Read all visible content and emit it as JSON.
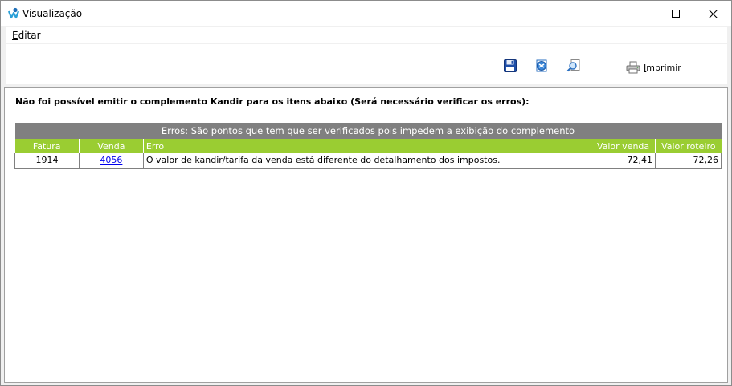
{
  "window": {
    "title": "Visualização"
  },
  "menu": {
    "editar": {
      "mnemonic": "E",
      "rest": "ditar"
    }
  },
  "toolbar": {
    "print_mnemonic": "I",
    "print_rest": "mprimir"
  },
  "content": {
    "message": "Não foi possível emitir o complemento Kandir para os itens abaixo (Será necessário verificar os erros):",
    "table": {
      "caption": "Erros: São pontos que tem que ser verificados pois impedem a exibição do complemento",
      "headers": [
        "Fatura",
        "Venda",
        "Erro",
        "Valor venda",
        "Valor roteiro"
      ],
      "rows": [
        {
          "fatura": "1914",
          "venda": "4056",
          "erro": "O valor de kandir/tarifa da venda está diferente do detalhamento dos impostos.",
          "valor_venda": "72,41",
          "valor_roteiro": "72,26"
        }
      ]
    }
  },
  "colors": {
    "header_green": "#9acd32",
    "caption_gray": "#808080",
    "link_blue": "#0000ee"
  }
}
